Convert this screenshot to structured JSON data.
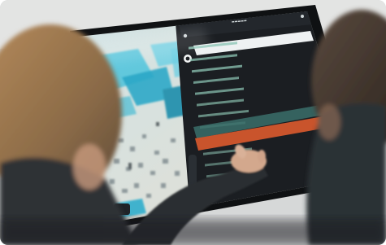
{
  "scene": {
    "accent_colors": {
      "map_water": "#35b8d6",
      "map_land": "#e9dfcf",
      "panel_dark": "#1b1e22",
      "selected_row": "#c9542c",
      "highlight_row": "#3a6f6a"
    },
    "panel_rows": [
      {
        "id": "row-1",
        "state": "normal"
      },
      {
        "id": "row-2",
        "state": "normal"
      },
      {
        "id": "row-3",
        "state": "normal"
      },
      {
        "id": "row-4",
        "state": "normal"
      },
      {
        "id": "row-5",
        "state": "normal"
      },
      {
        "id": "row-6",
        "state": "normal"
      },
      {
        "id": "row-7",
        "state": "normal"
      },
      {
        "id": "row-8",
        "state": "normal"
      },
      {
        "id": "row-9",
        "state": "highlight"
      },
      {
        "id": "row-10",
        "state": "selected"
      },
      {
        "id": "row-11",
        "state": "normal"
      },
      {
        "id": "row-12",
        "state": "normal"
      },
      {
        "id": "row-13",
        "state": "normal"
      }
    ],
    "icons": [
      "back-arrow-icon",
      "search-icon",
      "menu-icon",
      "checkbox-icon"
    ]
  }
}
